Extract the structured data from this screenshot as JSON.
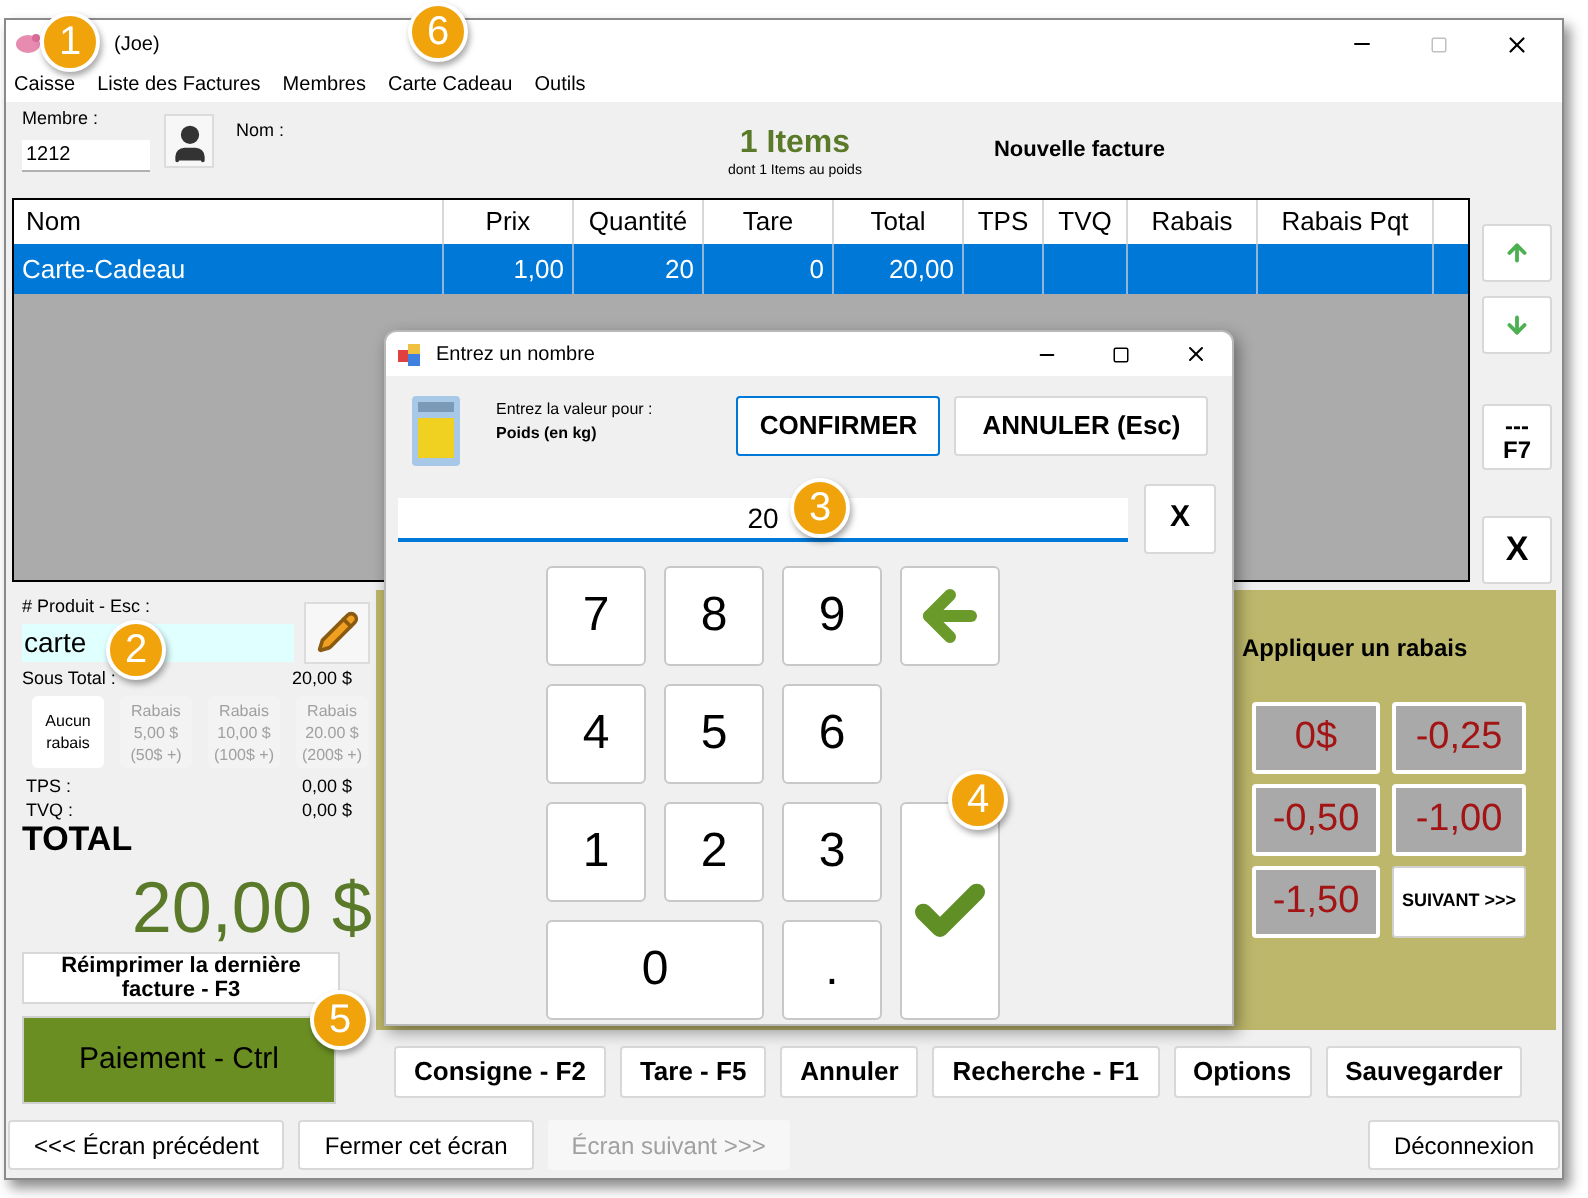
{
  "window": {
    "title": "(Joe)"
  },
  "menu": [
    "Caisse",
    "Liste des Factures",
    "Membres",
    "Carte Cadeau",
    "Outils"
  ],
  "member": {
    "label": "Membre :",
    "value": "1212",
    "name_label": "Nom :"
  },
  "summary": {
    "count": "1 Items",
    "detail": "dont 1 Items au poids",
    "invoice": "Nouvelle facture"
  },
  "table": {
    "columns": [
      "Nom",
      "Prix",
      "Quantité",
      "Tare",
      "Total",
      "TPS",
      "TVQ",
      "Rabais",
      "Rabais Pqt"
    ],
    "rows": [
      {
        "selected": true,
        "cells": [
          "Carte-Cadeau",
          "1,00",
          "20",
          "0",
          "20,00"
        ]
      }
    ]
  },
  "side_buttons": [
    {
      "kind": "up"
    },
    {
      "kind": "down"
    },
    {
      "kind": "text",
      "lines": [
        "---",
        "F7"
      ]
    },
    {
      "kind": "text",
      "lines": [
        "X"
      ]
    }
  ],
  "product": {
    "label": "# Produit - Esc :",
    "value": "carte"
  },
  "subtotal": {
    "label": "Sous Total :",
    "value": "20,00 $"
  },
  "discounts": [
    {
      "lines": [
        "Aucun",
        "rabais"
      ],
      "disabled": false
    },
    {
      "lines": [
        "Rabais",
        "5,00 $",
        "(50$ +)"
      ],
      "disabled": true
    },
    {
      "lines": [
        "Rabais",
        "10,00 $",
        "(100$ +)"
      ],
      "disabled": true
    },
    {
      "lines": [
        "Rabais",
        "20.00 $",
        "(200$ +)"
      ],
      "disabled": true
    }
  ],
  "taxes": [
    {
      "label": "TPS :",
      "value": "0,00 $"
    },
    {
      "label": "TVQ :",
      "value": "0,00 $"
    }
  ],
  "total": {
    "label": "TOTAL",
    "value": "20,00 $"
  },
  "reprint": "Réimprimer la dernière facture - F3",
  "payment": "Paiement - Ctrl",
  "rabais_panel": {
    "title": "Appliquer un rabais",
    "buttons": [
      {
        "kind": "amount",
        "label": "0$"
      },
      {
        "kind": "amount",
        "label": "-0,25"
      },
      {
        "kind": "amount",
        "label": "-0,50"
      },
      {
        "kind": "amount",
        "label": "-1,00"
      },
      {
        "kind": "amount",
        "label": "-1,50"
      },
      {
        "kind": "next",
        "label": "SUIVANT >>>"
      }
    ]
  },
  "actions": [
    "Consigne - F2",
    "Tare - F5",
    "Annuler",
    "Recherche - F1",
    "Options",
    "Sauvegarder"
  ],
  "nav": [
    {
      "label": "<<< Écran précédent",
      "disabled": false
    },
    {
      "label": "Fermer cet écran",
      "disabled": false
    },
    {
      "label": "Écran suivant >>>",
      "disabled": true
    },
    {
      "label": "Déconnexion",
      "disabled": false
    }
  ],
  "dialog": {
    "title": "Entrez un nombre",
    "prompt": "Entrez la valeur pour :",
    "field_name": "Poids (en kg)",
    "confirm": "CONFIRMER",
    "cancel": "ANNULER (Esc)",
    "value": "20",
    "clear": "X",
    "keypad": [
      [
        {
          "kind": "digit",
          "label": "7"
        },
        {
          "kind": "digit",
          "label": "8"
        },
        {
          "kind": "digit",
          "label": "9"
        },
        {
          "kind": "back"
        }
      ],
      [
        {
          "kind": "digit",
          "label": "4"
        },
        {
          "kind": "digit",
          "label": "5"
        },
        {
          "kind": "digit",
          "label": "6"
        }
      ],
      [
        {
          "kind": "digit",
          "label": "1"
        },
        {
          "kind": "digit",
          "label": "2"
        },
        {
          "kind": "digit",
          "label": "3"
        },
        {
          "kind": "enter"
        }
      ],
      [
        {
          "kind": "wide",
          "label": "0"
        },
        {
          "kind": "digit",
          "label": "."
        }
      ]
    ]
  },
  "callouts": [
    "1",
    "2",
    "3",
    "4",
    "5",
    "6"
  ]
}
